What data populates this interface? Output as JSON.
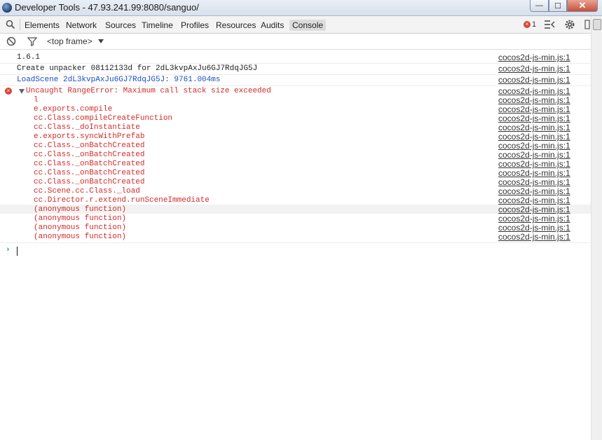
{
  "window": {
    "title": "Developer Tools - 47.93.241.99:8080/sanguo/",
    "min": "—",
    "max": "☐",
    "close": "✕"
  },
  "tabs": [
    "Elements",
    "Network",
    "Sources",
    "Timeline",
    "Profiles",
    "Resources",
    "Audits",
    "Console"
  ],
  "active_tab": "Console",
  "toolbar": {
    "error_count": "1",
    "error_glyph": "×"
  },
  "filter": {
    "frame": "<top frame>"
  },
  "messages": [
    {
      "text": "1.6.1",
      "source": "cocos2d-js-min.js:1",
      "color": "#222222"
    },
    {
      "text": "Create unpacker 08112133d for 2dL3kvpAxJu6GJ7RdqJG5J",
      "source": "cocos2d-js-min.js:1",
      "color": "#222222"
    },
    {
      "text": "LoadScene 2dL3kvpAxJu6GJ7RdqJG5J: 9761.004ms",
      "source": "cocos2d-js-min.js:1",
      "color": "#1a4fc4"
    }
  ],
  "error": {
    "glyph": "×",
    "message": "Uncaught RangeError: Maximum call stack size exceeded",
    "source": "cocos2d-js-min.js:1",
    "stack": [
      {
        "fn": "l",
        "source": "cocos2d-js-min.js:1"
      },
      {
        "fn": "e.exports.compile",
        "source": "cocos2d-js-min.js:1"
      },
      {
        "fn": "cc.Class.compileCreateFunction",
        "source": "cocos2d-js-min.js:1"
      },
      {
        "fn": "cc.Class._doInstantiate",
        "source": "cocos2d-js-min.js:1"
      },
      {
        "fn": "e.exports.syncWithPrefab",
        "source": "cocos2d-js-min.js:1"
      },
      {
        "fn": "cc.Class._onBatchCreated",
        "source": "cocos2d-js-min.js:1"
      },
      {
        "fn": "cc.Class._onBatchCreated",
        "source": "cocos2d-js-min.js:1"
      },
      {
        "fn": "cc.Class._onBatchCreated",
        "source": "cocos2d-js-min.js:1"
      },
      {
        "fn": "cc.Class._onBatchCreated",
        "source": "cocos2d-js-min.js:1"
      },
      {
        "fn": "cc.Class._onBatchCreated",
        "source": "cocos2d-js-min.js:1"
      },
      {
        "fn": "cc.Scene.cc.Class._load",
        "source": "cocos2d-js-min.js:1"
      },
      {
        "fn": "cc.Director.r.extend.runSceneImmediate",
        "source": "cocos2d-js-min.js:1"
      },
      {
        "fn": "(anonymous function)",
        "source": "cocos2d-js-min.js:1"
      },
      {
        "fn": "(anonymous function)",
        "source": "cocos2d-js-min.js:1"
      },
      {
        "fn": "(anonymous function)",
        "source": "cocos2d-js-min.js:1"
      },
      {
        "fn": "(anonymous function)",
        "source": "cocos2d-js-min.js:1"
      }
    ]
  },
  "prompt": {
    "glyph": "›"
  }
}
